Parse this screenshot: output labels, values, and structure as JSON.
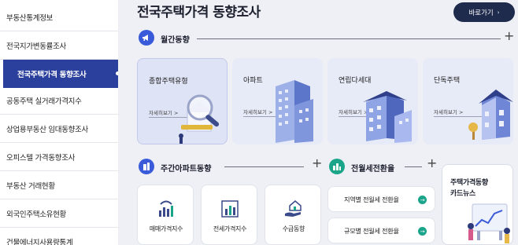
{
  "sidebar": {
    "items": [
      {
        "label": "부동산통계정보"
      },
      {
        "label": "전국지가변동률조사"
      },
      {
        "label": "전국주택가격 동향조사"
      },
      {
        "label": "공동주택 실거래가격지수"
      },
      {
        "label": "상업용부동산 임대동향조사"
      },
      {
        "label": "오피스텔 가격동향조사"
      },
      {
        "label": "부동산 거래현황"
      },
      {
        "label": "외국인주택소유현황"
      },
      {
        "label": "건물에너지사용량통계"
      }
    ]
  },
  "header": {
    "title": "전국주택가격 동향조사",
    "shortcut_label": "바로가기",
    "shortcut_arrow": "›"
  },
  "monthly": {
    "title": "월간동향",
    "icon": "megaphone-icon",
    "plus": "+",
    "cards": [
      {
        "label": "종합주택유형",
        "more": "자세히보기 >",
        "icon": "magnifier-house-illustration"
      },
      {
        "label": "아파트",
        "more": "자세히보기 >",
        "icon": "apartment-building-illustration"
      },
      {
        "label": "연립다세대",
        "more": "자세히보기 >",
        "icon": "row-house-illustration"
      },
      {
        "label": "단독주택",
        "more": "자세히보기 >",
        "icon": "detached-house-illustration"
      }
    ]
  },
  "weekly": {
    "title": "주간아파트동향",
    "icon": "building-icon",
    "plus": "+",
    "cards": [
      {
        "label": "매매가격지수",
        "icon": "wifi-chart-icon"
      },
      {
        "label": "전세가격지수",
        "icon": "bar-chart-icon"
      },
      {
        "label": "수급동향",
        "icon": "hand-house-icon"
      }
    ]
  },
  "rental": {
    "title": "전월세전환율",
    "icon": "city-icon",
    "plus": "+",
    "items": [
      {
        "label": "지역별 전월세 전환율",
        "go": "→"
      },
      {
        "label": "규모별 전월세 전환율",
        "go": "→"
      }
    ]
  },
  "card_news": {
    "title_line1": "주택가격동향",
    "title_line2": "카드뉴스",
    "icon": "chart-board-illustration"
  },
  "colors": {
    "sidebar_active": "#2b3f9d",
    "shortcut_bg": "#1f2b4d",
    "accent_blue": "#3a5bd9",
    "accent_green": "#1aa58a"
  }
}
